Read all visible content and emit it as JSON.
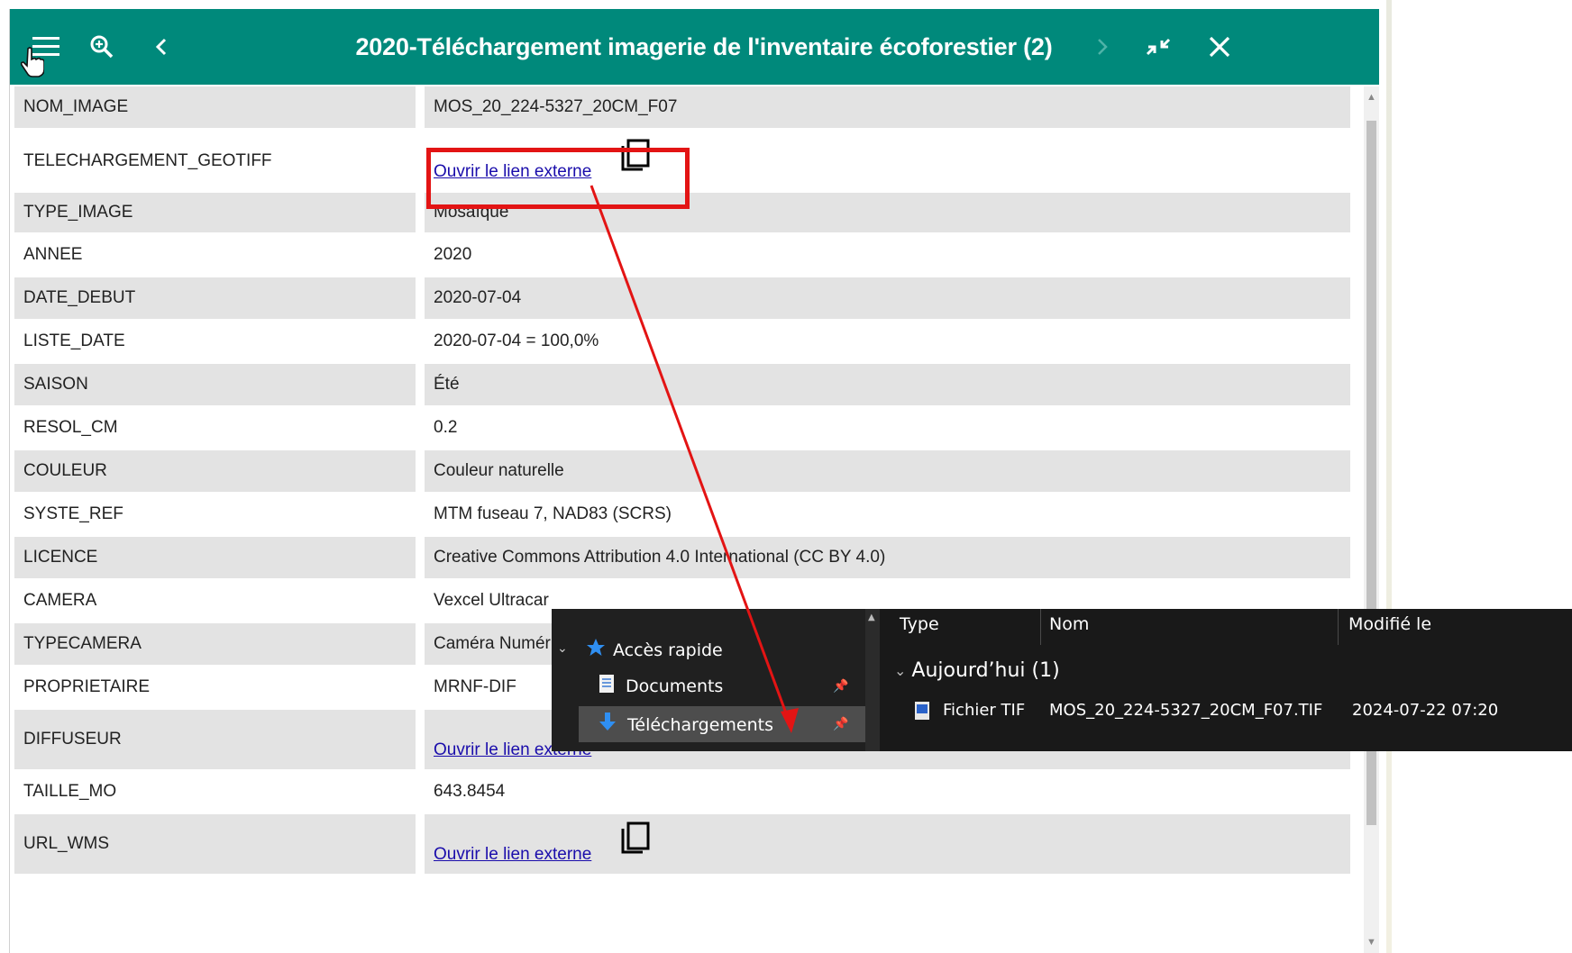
{
  "panel": {
    "title": "2020-Téléchargement imagerie de l'inventaire écoforestier (2)"
  },
  "rows": [
    {
      "key": "NOM_IMAGE",
      "value": "MOS_20_224-5327_20CM_F07"
    },
    {
      "key": "TELECHARGEMENT_GEOTIFF",
      "value": "Ouvrir le lien externe"
    },
    {
      "key": "TYPE_IMAGE",
      "value": "Mosaïque"
    },
    {
      "key": "ANNEE",
      "value": "2020"
    },
    {
      "key": "DATE_DEBUT",
      "value": "2020-07-04"
    },
    {
      "key": "LISTE_DATE",
      "value": "2020-07-04 = 100,0%"
    },
    {
      "key": "SAISON",
      "value": "Été"
    },
    {
      "key": "RESOL_CM",
      "value": "0.2"
    },
    {
      "key": "COULEUR",
      "value": "Couleur naturelle"
    },
    {
      "key": "SYSTE_REF",
      "value": "MTM fuseau 7, NAD83 (SCRS)"
    },
    {
      "key": "LICENCE",
      "value": "Creative Commons Attribution 4.0 International (CC BY 4.0)"
    },
    {
      "key": "CAMERA",
      "value": "Vexcel Ultracar"
    },
    {
      "key": "TYPECAMERA",
      "value": "Caméra Numér"
    },
    {
      "key": "PROPRIETAIRE",
      "value": "MRNF-DIF"
    },
    {
      "key": "DIFFUSEUR",
      "value": "Ouvrir le lien externe"
    },
    {
      "key": "TAILLE_MO",
      "value": "643.8454"
    },
    {
      "key": "URL_WMS",
      "value": "Ouvrir le lien externe"
    }
  ],
  "explorer": {
    "nav": {
      "quick_access": "Accès rapide",
      "documents": "Documents",
      "downloads": "Téléchargements"
    },
    "columns": {
      "type": "Type",
      "name": "Nom",
      "modified": "Modifié le"
    },
    "group_label": "Aujourd’hui (1)",
    "file": {
      "type": "Fichier TIF",
      "name": "MOS_20_224-5327_20CM_F07.TIF",
      "modified": "2024-07-22 07:20"
    }
  },
  "colors": {
    "titlebar": "#00897b",
    "highlight": "#e31414",
    "link": "#1a0dab",
    "row_shaded": "#e3e3e3",
    "explorer_bg": "#191919"
  },
  "icons": [
    "menu-icon",
    "cursor-hand-icon",
    "zoom-icon",
    "back-icon",
    "forward-icon",
    "collapse-icon",
    "close-icon",
    "copy-icon",
    "star-icon",
    "document-icon",
    "download-icon",
    "pin-icon",
    "tif-file-icon"
  ]
}
